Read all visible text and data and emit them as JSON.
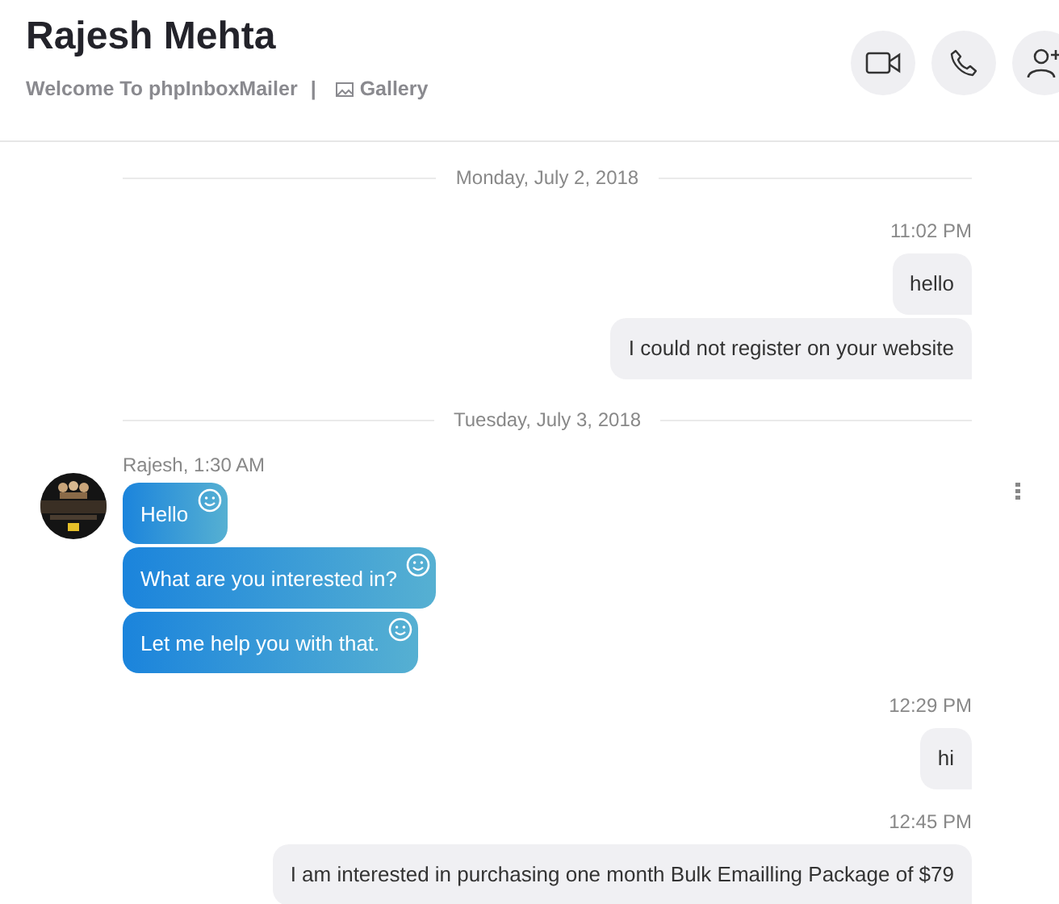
{
  "header": {
    "title": "Rajesh Mehta",
    "subtitle": "Welcome To phpInboxMailer",
    "separator": "|",
    "gallery_label": "Gallery"
  },
  "messages": [
    {
      "kind": "date",
      "text": "Monday, July 2, 2018"
    },
    {
      "kind": "time",
      "text": "11:02 PM"
    },
    {
      "kind": "outgoing",
      "text": "hello"
    },
    {
      "kind": "outgoing",
      "text": "I could not register on your website"
    },
    {
      "kind": "date",
      "text": "Tuesday, July 3, 2018"
    },
    {
      "kind": "incoming_group",
      "sender": "Rajesh, 1:30 AM",
      "bubbles": [
        "Hello",
        "What are you interested in?",
        "Let me help you with that."
      ]
    },
    {
      "kind": "time",
      "text": "12:29 PM"
    },
    {
      "kind": "outgoing",
      "text": "hi"
    },
    {
      "kind": "time",
      "text": "12:45 PM"
    },
    {
      "kind": "outgoing",
      "text": "I am interested in purchasing one month Bulk Emailling Package of $79"
    }
  ]
}
